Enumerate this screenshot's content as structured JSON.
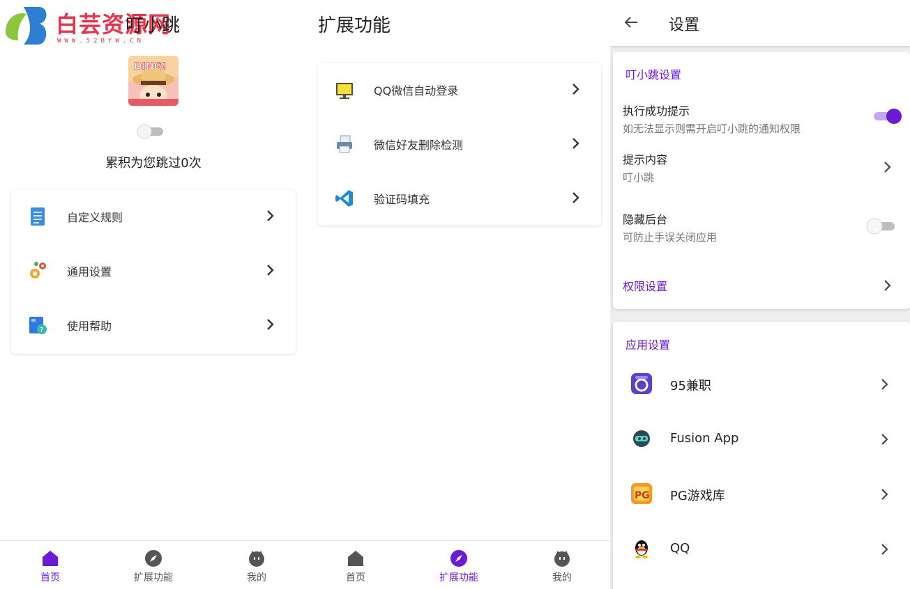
{
  "watermark": {
    "brand": "白芸资源网",
    "url": "WWW.52BYW.CN"
  },
  "home": {
    "title": "叮小跳",
    "count_text": "累积为您跳过0次",
    "toggle_on": false,
    "menu": [
      {
        "label": "自定义规则",
        "icon": "document-icon"
      },
      {
        "label": "通用设置",
        "icon": "gears-icon"
      },
      {
        "label": "使用帮助",
        "icon": "help-book-icon"
      }
    ]
  },
  "extensions": {
    "title": "扩展功能",
    "items": [
      {
        "label": "QQ微信自动登录",
        "icon": "monitor-icon"
      },
      {
        "label": "微信好友删除检测",
        "icon": "printer-icon"
      },
      {
        "label": "验证码填充",
        "icon": "vscode-icon"
      }
    ]
  },
  "nav": {
    "home": "首页",
    "extensions": "扩展功能",
    "mine": "我的"
  },
  "settings": {
    "title": "设置",
    "section1_title": "叮小跳设置",
    "success_tip": {
      "title": "执行成功提示",
      "sub": "如无法显示则需开启叮小跳的通知权限",
      "on": true
    },
    "tip_content": {
      "title": "提示内容",
      "sub": "叮小跳"
    },
    "hide_background": {
      "title": "隐藏后台",
      "sub": "可防止手误关闭应用",
      "on": false
    },
    "permissions": "权限设置",
    "section2_title": "应用设置",
    "apps": [
      {
        "label": "95兼职",
        "icon": "95-jianzhi-icon"
      },
      {
        "label": "Fusion App",
        "icon": "fusion-app-icon"
      },
      {
        "label": "PG游戏库",
        "icon": "pg-game-icon"
      },
      {
        "label": "QQ",
        "icon": "qq-penguin-icon"
      }
    ]
  },
  "colors": {
    "accent": "#6a1bd8",
    "brand_red": "#e8344a"
  }
}
